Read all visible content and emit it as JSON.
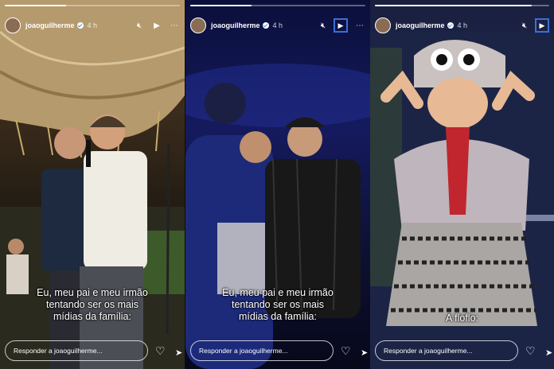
{
  "stories": [
    {
      "username": "joaoguilherme",
      "time": "4 h",
      "caption_line1": "Eu, meu pai e meu irmão",
      "caption_line2": "tentando ser os mais",
      "caption_line3": "mídias da família:",
      "reply_placeholder": "Responder a joaoguilherme...",
      "progress_fraction": 0.35
    },
    {
      "username": "joaoguilherme",
      "time": "4 h",
      "caption_line1": "Eu, meu pai e meu irmão",
      "caption_line2": "tentando ser os mais",
      "caption_line3": "mídias da família:",
      "reply_placeholder": "Responder a joaoguilherme...",
      "progress_fraction": 0.35
    },
    {
      "username": "joaoguilherme",
      "time": "4 h",
      "caption_line1": "A floflo:",
      "reply_placeholder": "Responder a joaoguilherme...",
      "progress_fraction": 0.9
    }
  ],
  "icons": {
    "mute": "speaker-muted-icon",
    "play": "play-icon",
    "like": "heart-icon",
    "share": "send-icon",
    "verified": "verified-badge-icon"
  },
  "colors": {
    "play_highlight": "#3b6fd8",
    "verified": "#3897f0"
  }
}
